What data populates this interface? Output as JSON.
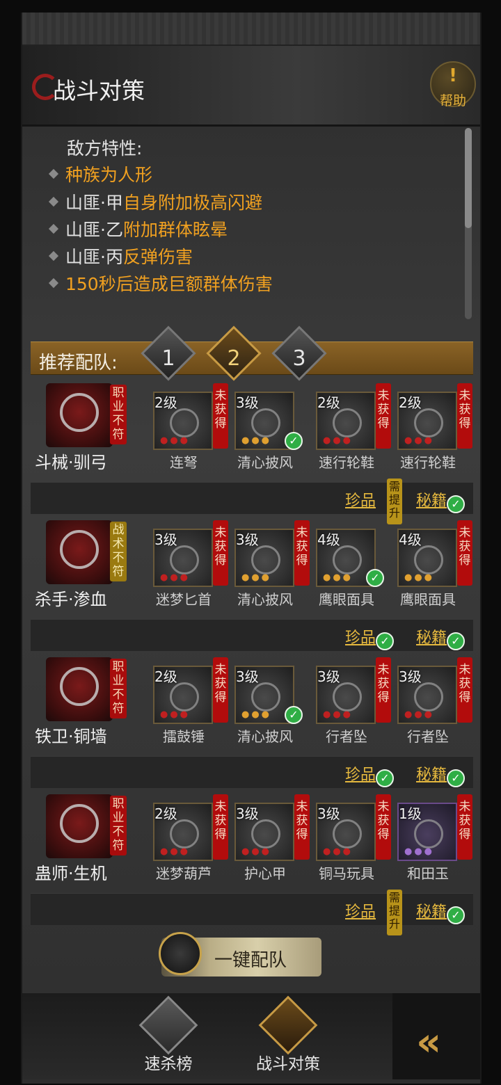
{
  "header": {
    "title": "战斗对策",
    "help_label": "帮助",
    "help_mark": "!"
  },
  "traits": {
    "title": "敌方特性:",
    "items": [
      {
        "prefix": "",
        "highlight": "种族为人形"
      },
      {
        "prefix": "山匪·甲",
        "highlight": "自身附加极高闪避"
      },
      {
        "prefix": "山匪·乙",
        "highlight": "附加群体眩晕"
      },
      {
        "prefix": "山匪·丙",
        "highlight": "反弹伤害"
      },
      {
        "prefix": "",
        "highlight": "150秒后造成巨额群体伤害"
      }
    ]
  },
  "recommend": {
    "label": "推荐配队:",
    "tabs": [
      "1",
      "2",
      "3"
    ],
    "active_tab": "2"
  },
  "rows": [
    {
      "hero_name": "斗械·驯弓",
      "hero_note": "职业不符",
      "note_color": "red",
      "equipment": [
        {
          "level": "2级",
          "name": "连弩",
          "tag": "",
          "owned": false,
          "rarity": "red"
        },
        {
          "level": "3级",
          "name": "清心披风",
          "tag": "",
          "owned": true,
          "rarity": "gold"
        },
        {
          "level": "2级",
          "name": "速行轮鞋",
          "tag": "未获得",
          "owned": false,
          "rarity": "red"
        },
        {
          "level": "2级",
          "name": "速行轮鞋",
          "tag": "未获得",
          "owned": false,
          "rarity": "red"
        }
      ],
      "eq0_tag": "未获得",
      "treasure": "珍品",
      "treasure_need": "需提升",
      "treasure_ok": false,
      "secret": "秘籍",
      "secret_ok": true
    },
    {
      "hero_name": "杀手·渗血",
      "hero_note": "战术不符",
      "note_color": "gold",
      "equipment": [
        {
          "level": "3级",
          "name": "迷梦匕首",
          "tag": "未获得",
          "owned": false,
          "rarity": "red"
        },
        {
          "level": "3级",
          "name": "清心披风",
          "tag": "未获得",
          "owned": false,
          "rarity": "gold"
        },
        {
          "level": "4级",
          "name": "鹰眼面具",
          "tag": "",
          "owned": true,
          "rarity": "gold"
        },
        {
          "level": "4级",
          "name": "鹰眼面具",
          "tag": "未获得",
          "owned": false,
          "rarity": "gold"
        }
      ],
      "treasure": "珍品",
      "treasure_need": "",
      "treasure_ok": true,
      "secret": "秘籍",
      "secret_ok": true
    },
    {
      "hero_name": "铁卫·铜墙",
      "hero_note": "职业不符",
      "note_color": "red",
      "equipment": [
        {
          "level": "2级",
          "name": "擂鼓锤",
          "tag": "未获得",
          "owned": false,
          "rarity": "red"
        },
        {
          "level": "3级",
          "name": "清心披风",
          "tag": "",
          "owned": true,
          "rarity": "gold"
        },
        {
          "level": "3级",
          "name": "行者坠",
          "tag": "未获得",
          "owned": false,
          "rarity": "red"
        },
        {
          "level": "3级",
          "name": "行者坠",
          "tag": "未获得",
          "owned": false,
          "rarity": "red"
        }
      ],
      "treasure": "珍品",
      "treasure_need": "",
      "treasure_ok": true,
      "secret": "秘籍",
      "secret_ok": true
    },
    {
      "hero_name": "蛊师·生机",
      "hero_note": "职业不符",
      "note_color": "red",
      "equipment": [
        {
          "level": "2级",
          "name": "迷梦葫芦",
          "tag": "未获得",
          "owned": false,
          "rarity": "red"
        },
        {
          "level": "3级",
          "name": "护心甲",
          "tag": "未获得",
          "owned": false,
          "rarity": "red"
        },
        {
          "level": "3级",
          "name": "铜马玩具",
          "tag": "未获得",
          "owned": false,
          "rarity": "red"
        },
        {
          "level": "1级",
          "name": "和田玉",
          "tag": "未获得",
          "owned": false,
          "rarity": "purple"
        }
      ],
      "treasure": "珍品",
      "treasure_need": "需提升",
      "treasure_ok": false,
      "secret": "秘籍",
      "secret_ok": true
    }
  ],
  "one_key": {
    "label": "一键配队"
  },
  "nav": {
    "items": [
      "速杀榜",
      "战斗对策"
    ],
    "active": "战斗对策"
  },
  "colors": {
    "highlight": "#f0a020",
    "tag_red": "#b20c0c",
    "link_gold": "#e6b93e",
    "owned_green": "#2fae45"
  }
}
